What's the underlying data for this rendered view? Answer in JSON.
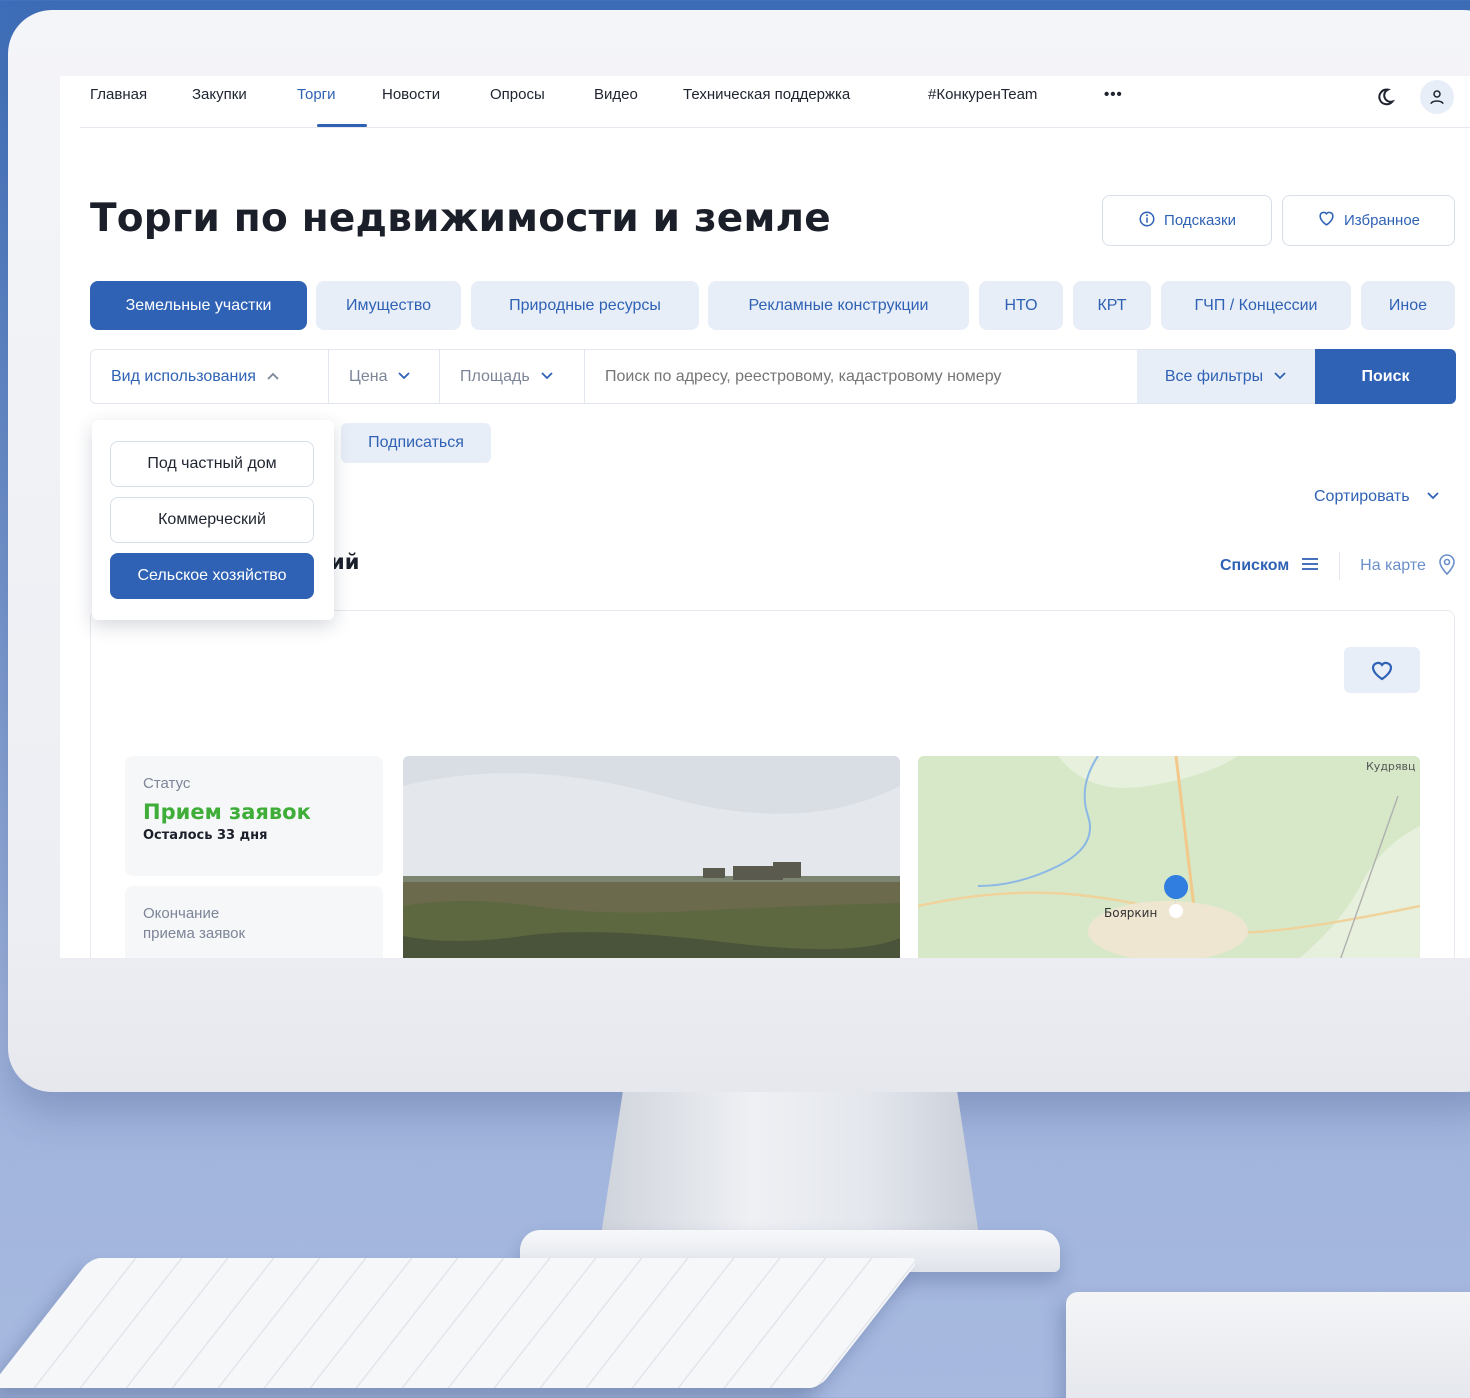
{
  "nav": {
    "items": [
      "Главная",
      "Закупки",
      "Торги",
      "Новости",
      "Опросы",
      "Видео",
      "Техническая поддержка",
      "#КонкуренTeam"
    ],
    "more": "•••",
    "active": "Торги"
  },
  "page": {
    "title": "Торги по недвижимости и земле",
    "hints_label": "Подсказки",
    "favorites_label": "Избранное"
  },
  "categories": [
    "Земельные участки",
    "Имущество",
    "Природные ресурсы",
    "Рекламные конструкции",
    "НТО",
    "КРТ",
    "ГЧП / Концессии",
    "Иное"
  ],
  "filters": {
    "usage_type": "Вид использования",
    "price": "Цена",
    "area": "Площадь",
    "search_placeholder": "Поиск по адресу, реестровому, кадастровому номеру",
    "all_filters": "Все фильтры",
    "search_button": "Поиск"
  },
  "usage_dropdown": {
    "options": [
      "Под частный дом",
      "Коммерческий",
      "Сельское хозяйство"
    ],
    "selected": "Сельское хозяйство"
  },
  "subscribe_label": "Подписаться",
  "sort_label": "Сортировать",
  "results_title_fragment": "ий",
  "view": {
    "list_label": "Списком",
    "map_label": "На карте",
    "active": "Списком"
  },
  "listing": {
    "status_label": "Статус",
    "status_value": "Прием заявок",
    "remaining": "Осталось 33 дня",
    "deadline_label": "Окончание приема заявок",
    "map_places": [
      "Кудрявц",
      "Бояркин"
    ]
  },
  "colors": {
    "accent": "#2f62b5",
    "accent_light": "#e8eef8",
    "status_green": "#3fae38"
  }
}
